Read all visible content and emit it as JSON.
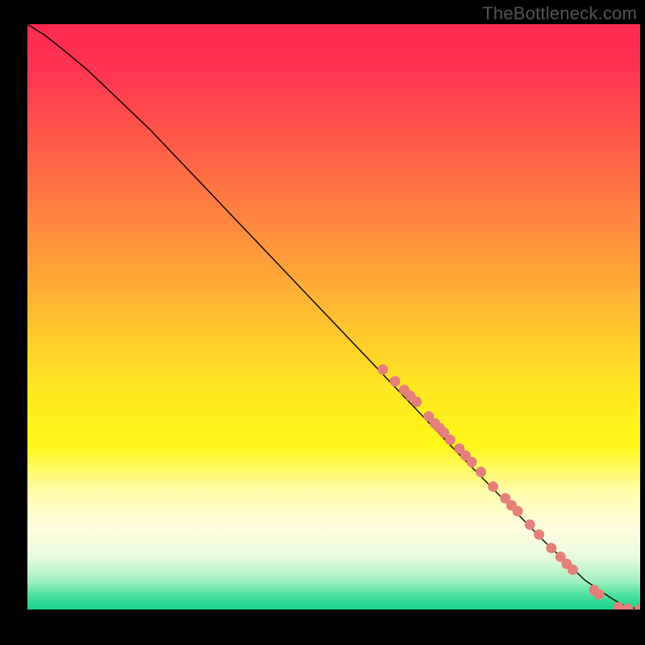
{
  "watermark": "TheBottleneck.com",
  "chart_data": {
    "type": "line",
    "title": "",
    "xlabel": "",
    "ylabel": "",
    "xlim": [
      0,
      100
    ],
    "ylim": [
      0,
      100
    ],
    "grid": false,
    "legend": false,
    "background_gradient": {
      "stops": [
        {
          "offset": 0.0,
          "color": "#ff2a4f"
        },
        {
          "offset": 0.08,
          "color": "#ff3452"
        },
        {
          "offset": 0.2,
          "color": "#ff5a48"
        },
        {
          "offset": 0.35,
          "color": "#ff8b3e"
        },
        {
          "offset": 0.5,
          "color": "#ffbf30"
        },
        {
          "offset": 0.62,
          "color": "#ffe722"
        },
        {
          "offset": 0.72,
          "color": "#fff71a"
        },
        {
          "offset": 0.8,
          "color": "#fffcae"
        },
        {
          "offset": 0.86,
          "color": "#fffde0"
        },
        {
          "offset": 0.91,
          "color": "#e8fbdc"
        },
        {
          "offset": 0.95,
          "color": "#a6f0c1"
        },
        {
          "offset": 0.975,
          "color": "#4ee19e"
        },
        {
          "offset": 1.0,
          "color": "#18d28a"
        }
      ]
    },
    "series": [
      {
        "name": "curve",
        "type": "line",
        "color": "#000000",
        "stroke_width": 1.4,
        "x": [
          0,
          3,
          6,
          10,
          15,
          20,
          30,
          40,
          50,
          60,
          70,
          78,
          84,
          88,
          91,
          93.5,
          95.5,
          97,
          98.5,
          100
        ],
        "y": [
          100,
          98,
          95.5,
          92,
          87,
          82,
          71,
          60,
          49,
          38,
          27,
          18.5,
          12,
          8,
          5,
          3.2,
          1.8,
          0.9,
          0.3,
          0.1
        ]
      },
      {
        "name": "points",
        "type": "scatter",
        "color": "#e57f7a",
        "radius": 6.5,
        "x": [
          58,
          60,
          61.5,
          62.5,
          63.5,
          65.5,
          66.5,
          67.3,
          68,
          69,
          70.5,
          71.5,
          72.5,
          74,
          76,
          78,
          79,
          80,
          82,
          83.5,
          85.5,
          87,
          88,
          89,
          92.5,
          93.3,
          96.5,
          98,
          100
        ],
        "y": [
          41,
          39,
          37.5,
          36.5,
          35.5,
          33,
          31.8,
          31,
          30.2,
          29,
          27.5,
          26.3,
          25.2,
          23.5,
          21,
          19,
          17.8,
          16.8,
          14.5,
          12.8,
          10.5,
          9,
          7.8,
          6.8,
          3.3,
          2.6,
          0.4,
          0.15,
          0.1
        ]
      }
    ]
  }
}
